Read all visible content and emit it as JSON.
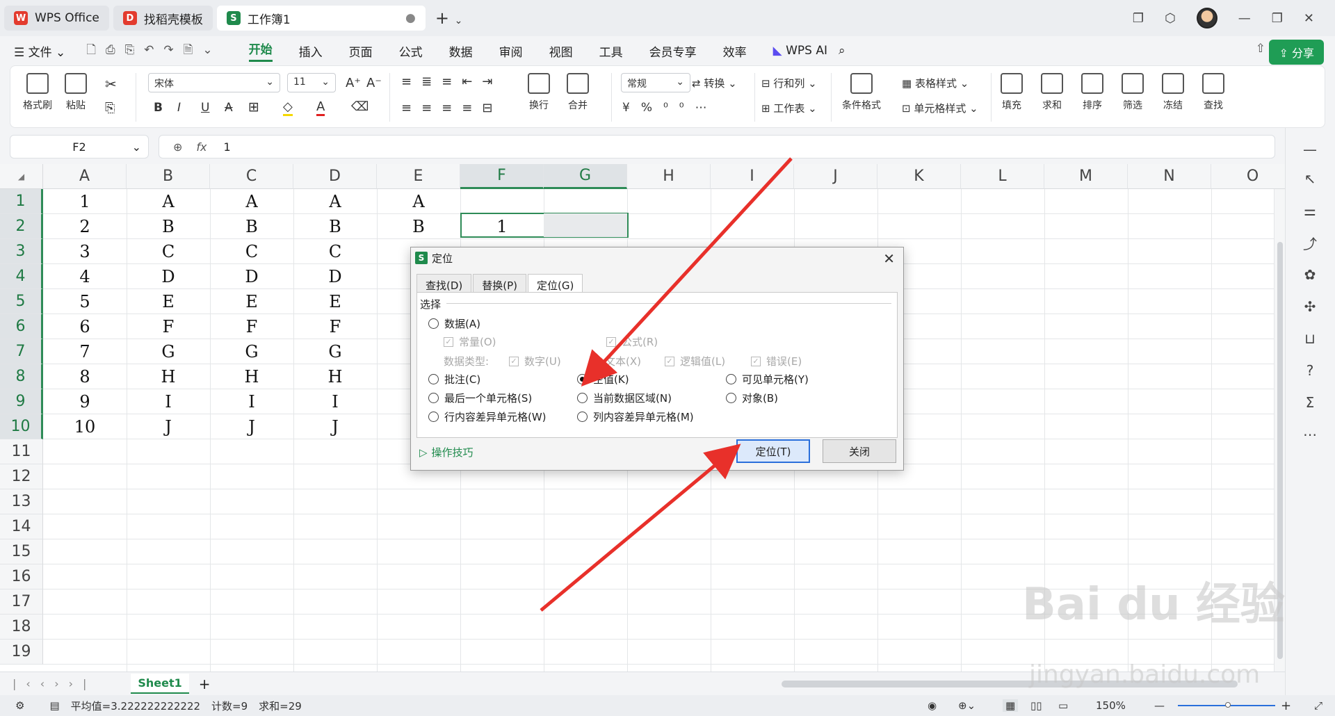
{
  "tabs": [
    {
      "label": "WPS Office",
      "color": "#e33b2e"
    },
    {
      "label": "找稻壳模板",
      "color": "#e33b2e"
    },
    {
      "label": "工作簿1",
      "color": "#1f8a4c"
    }
  ],
  "menu": {
    "file": "文件",
    "items": [
      "开始",
      "插入",
      "页面",
      "公式",
      "数据",
      "审阅",
      "视图",
      "工具",
      "会员专享",
      "效率"
    ],
    "active": "开始",
    "wps_ai": "WPS AI",
    "share": "分享"
  },
  "ribbon": {
    "format_painter": "格式刷",
    "paste": "粘贴",
    "font_name": "宋体",
    "font_size": "11",
    "number_format": "常规",
    "wrap": "换行",
    "merge": "合并",
    "convert": "转换",
    "row_col": "行和列",
    "worksheet": "工作表",
    "cond_format": "条件格式",
    "table_style": "表格样式",
    "cell_style": "单元格样式",
    "fill": "填充",
    "sum": "求和",
    "sort": "排序",
    "filter": "筛选",
    "freeze": "冻结",
    "find": "查找"
  },
  "formula_bar": {
    "cell_ref": "F2",
    "fx": "fx",
    "value": "1"
  },
  "columns": [
    "A",
    "B",
    "C",
    "D",
    "E",
    "F",
    "G",
    "H",
    "I",
    "J",
    "K",
    "L",
    "M",
    "N",
    "O"
  ],
  "rows": [
    "1",
    "2",
    "3",
    "4",
    "5",
    "6",
    "7",
    "8",
    "9",
    "10",
    "11",
    "12",
    "13",
    "14",
    "15",
    "16",
    "17",
    "18",
    "19"
  ],
  "cells": {
    "A": [
      "1",
      "2",
      "3",
      "4",
      "5",
      "6",
      "7",
      "8",
      "9",
      "10"
    ],
    "B": [
      "A",
      "B",
      "C",
      "D",
      "E",
      "F",
      "G",
      "H",
      "I",
      "J"
    ],
    "C": [
      "A",
      "B",
      "C",
      "D",
      "E",
      "F",
      "G",
      "H",
      "I",
      "J"
    ],
    "D": [
      "A",
      "B",
      "C",
      "D",
      "E",
      "F",
      "G",
      "H",
      "I",
      "J"
    ],
    "E": [
      "A",
      "B"
    ],
    "F2": "1"
  },
  "sheet": {
    "name": "Sheet1"
  },
  "status": {
    "average": "平均值=3.222222222222",
    "count": "计数=9",
    "sum": "求和=29",
    "zoom": "150%"
  },
  "dialog": {
    "title": "定位",
    "tabs": [
      "查找(D)",
      "替换(P)",
      "定位(G)"
    ],
    "active_tab": "定位(G)",
    "group": "选择",
    "opt_data": "数据(A)",
    "chk_const": "常量(O)",
    "chk_formula": "公式(R)",
    "data_type_label": "数据类型:",
    "chk_number": "数字(U)",
    "chk_text": "文本(X)",
    "chk_logic": "逻辑值(L)",
    "chk_error": "错误(E)",
    "opt_comment": "批注(C)",
    "opt_blank": "空值(K)",
    "opt_visible": "可见单元格(Y)",
    "opt_last": "最后一个单元格(S)",
    "opt_region": "当前数据区域(N)",
    "opt_object": "对象(B)",
    "opt_rowdiff": "行内容差异单元格(W)",
    "opt_coldiff": "列内容差异单元格(M)",
    "tips": "操作技巧",
    "btn_locate": "定位(T)",
    "btn_close": "关闭",
    "selected": "空值(K)"
  },
  "watermark": {
    "logo": "Bai du 经验",
    "url": "jingyan.baidu.com"
  },
  "colors": {
    "accent": "#1f8a4c",
    "arrow": "#e8302a",
    "primary_button_border": "#2a6fdb"
  }
}
